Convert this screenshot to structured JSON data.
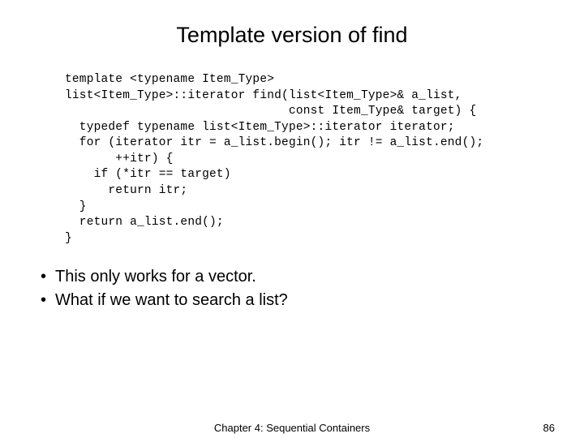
{
  "title": "Template version of find",
  "code": "template <typename Item_Type>\nlist<Item_Type>::iterator find(list<Item_Type>& a_list,\n                               const Item_Type& target) {\n  typedef typename list<Item_Type>::iterator iterator;\n  for (iterator itr = a_list.begin(); itr != a_list.end();\n       ++itr) {\n    if (*itr == target)\n      return itr;\n  }\n  return a_list.end();\n}",
  "bullets": [
    "This only works for a vector.",
    "What if we want to search a list?"
  ],
  "footer": {
    "center": "Chapter 4: Sequential Containers",
    "right": "86"
  }
}
